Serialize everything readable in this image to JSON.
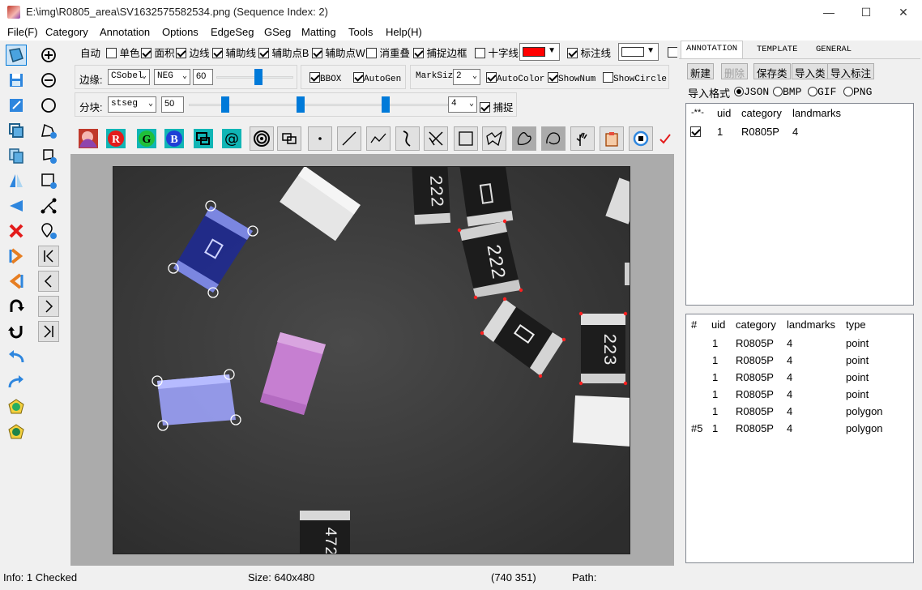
{
  "window": {
    "title": "E:\\img\\R0805_area\\SV1632575582534.png (Sequence Index: 2)",
    "minimize": "—",
    "maximize": "☐",
    "close": "✕"
  },
  "menu": [
    "File(F)",
    "Category",
    "Annotation",
    "Options",
    "EdgeSeg",
    "GSeg",
    "Matting",
    "Tools",
    "Help(H)"
  ],
  "row1": {
    "auto": "自动",
    "checks": [
      {
        "label": "单色",
        "checked": false
      },
      {
        "label": "面积",
        "checked": true
      },
      {
        "label": "边线",
        "checked": true
      },
      {
        "label": "辅助线",
        "checked": true
      },
      {
        "label": "辅助点B",
        "checked": true
      },
      {
        "label": "辅助点W",
        "checked": true
      },
      {
        "label": "消重叠",
        "checked": false
      },
      {
        "label": "捕捉边框",
        "checked": true
      },
      {
        "label": "十字线",
        "checked": false
      }
    ],
    "color1": "#ff0000",
    "label_check": {
      "label": "标注线",
      "checked": true
    },
    "color2": "#ffffff"
  },
  "row2": {
    "edge_label": "边缘:",
    "edge_combo": "CSobel",
    "neg_combo": "NEG",
    "value": "60",
    "bbox": {
      "label": "BBOX",
      "checked": true
    },
    "autogen": {
      "label": "AutoGen",
      "checked": true
    },
    "marksize_label": "MarkSiz",
    "marksize": "2",
    "autocolor": {
      "label": "AutoColor",
      "checked": true
    },
    "shownum": {
      "label": "ShowNum",
      "checked": true
    },
    "showcircle": {
      "label": "ShowCircle",
      "checked": false
    }
  },
  "row3": {
    "split_label": "分块:",
    "seg_combo": "stseg",
    "value": "50",
    "count": "4",
    "capture": {
      "label": "捕捉",
      "checked": true
    }
  },
  "icon_row": [
    "photo-icon",
    "R",
    "G",
    "B",
    "shapes-icon",
    "@",
    "spiral-icon",
    "swap-icon",
    "point-icon",
    "line-icon",
    "polyline-icon",
    "curve-icon",
    "scissors-icon",
    "rectangle-icon",
    "polygon-icon",
    "freeform-icon",
    "lasso-icon",
    "hand-icon",
    "clipboard-icon",
    "record-icon",
    "check-icon"
  ],
  "tabs": [
    "ANNOTATION",
    "TEMPLATE",
    "GENERAL"
  ],
  "panel_buttons": {
    "new": "新建",
    "delete": "删除",
    "save_class": "保存类",
    "import_class": "导入类",
    "import_label": "导入标注"
  },
  "import_format": {
    "label": "导入格式",
    "options": [
      "JSON",
      "BMP",
      "GIF",
      "PNG"
    ],
    "selected": "JSON"
  },
  "categories_table": {
    "headers": [
      "-**-",
      "uid",
      "category",
      "landmarks"
    ],
    "rows": [
      {
        "checked": true,
        "uid": "1",
        "category": "R0805P",
        "landmarks": "4"
      }
    ]
  },
  "objects_table": {
    "headers": [
      "#",
      "uid",
      "category",
      "landmarks",
      "type"
    ],
    "rows": [
      {
        "num": "",
        "uid": "1",
        "category": "R0805P",
        "landmarks": "4",
        "type": "point"
      },
      {
        "num": "",
        "uid": "1",
        "category": "R0805P",
        "landmarks": "4",
        "type": "point"
      },
      {
        "num": "",
        "uid": "1",
        "category": "R0805P",
        "landmarks": "4",
        "type": "point"
      },
      {
        "num": "",
        "uid": "1",
        "category": "R0805P",
        "landmarks": "4",
        "type": "point"
      },
      {
        "num": "",
        "uid": "1",
        "category": "R0805P",
        "landmarks": "4",
        "type": "polygon"
      },
      {
        "num": "#5",
        "uid": "1",
        "category": "R0805P",
        "landmarks": "4",
        "type": "polygon"
      }
    ]
  },
  "image_labels": {
    "chip1": "222",
    "chip2": "222",
    "chip3": "223",
    "chip4": "472"
  },
  "status": {
    "info": "Info: 1 Checked",
    "size": "Size: 640x480",
    "coords": "(740  351)",
    "path": "Path:"
  }
}
